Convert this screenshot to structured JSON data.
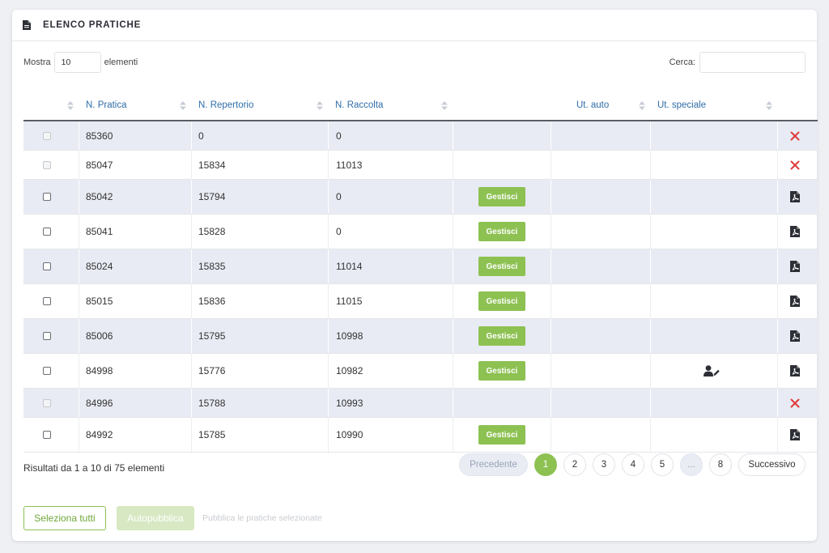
{
  "header": {
    "title": "ELENCO PRATICHE",
    "icon": "document-icon"
  },
  "toolbar": {
    "show_label": "Mostra",
    "page_length": "10",
    "elements_label": "elementi",
    "search_label": "Cerca:",
    "search_value": ""
  },
  "table": {
    "columns": [
      "",
      "N. Pratica",
      "N. Repertorio",
      "N. Raccolta",
      "",
      "Ut. auto",
      "Ut. speciale",
      ""
    ],
    "rows": [
      {
        "pratica": "85360",
        "repertorio": "0",
        "raccolta": "0",
        "checkbox_enabled": false,
        "gestisci": false,
        "speciale_icon": false,
        "action": "delete"
      },
      {
        "pratica": "85047",
        "repertorio": "15834",
        "raccolta": "11013",
        "checkbox_enabled": false,
        "gestisci": false,
        "speciale_icon": false,
        "action": "delete"
      },
      {
        "pratica": "85042",
        "repertorio": "15794",
        "raccolta": "0",
        "checkbox_enabled": true,
        "gestisci": true,
        "speciale_icon": false,
        "action": "pdf"
      },
      {
        "pratica": "85041",
        "repertorio": "15828",
        "raccolta": "0",
        "checkbox_enabled": true,
        "gestisci": true,
        "speciale_icon": false,
        "action": "pdf"
      },
      {
        "pratica": "85024",
        "repertorio": "15835",
        "raccolta": "11014",
        "checkbox_enabled": true,
        "gestisci": true,
        "speciale_icon": false,
        "action": "pdf"
      },
      {
        "pratica": "85015",
        "repertorio": "15836",
        "raccolta": "11015",
        "checkbox_enabled": true,
        "gestisci": true,
        "speciale_icon": false,
        "action": "pdf"
      },
      {
        "pratica": "85006",
        "repertorio": "15795",
        "raccolta": "10998",
        "checkbox_enabled": true,
        "gestisci": true,
        "speciale_icon": false,
        "action": "pdf"
      },
      {
        "pratica": "84998",
        "repertorio": "15776",
        "raccolta": "10982",
        "checkbox_enabled": true,
        "gestisci": true,
        "speciale_icon": true,
        "action": "pdf"
      },
      {
        "pratica": "84996",
        "repertorio": "15788",
        "raccolta": "10993",
        "checkbox_enabled": false,
        "gestisci": false,
        "speciale_icon": false,
        "action": "delete"
      },
      {
        "pratica": "84992",
        "repertorio": "15785",
        "raccolta": "10990",
        "checkbox_enabled": true,
        "gestisci": true,
        "speciale_icon": false,
        "action": "pdf"
      }
    ],
    "gestisci_label": "Gestisci"
  },
  "footer": {
    "info": "Risultati da 1 a 10 di 75 elementi",
    "prev_label": "Precedente",
    "pages": [
      "1",
      "2",
      "3",
      "4",
      "5",
      "...",
      "8"
    ],
    "active_page": "1",
    "next_label": "Successivo"
  },
  "actions": {
    "select_all_label": "Seleziona tutti",
    "autopublish_label": "Autopubblica",
    "hint": "Pubblica le pratiche selezionate"
  },
  "colors": {
    "accent_green": "#8dc152",
    "delete_red": "#e03a3a",
    "header_link_blue": "#2f6da8",
    "row_alt_bg": "#e8ebf3"
  }
}
